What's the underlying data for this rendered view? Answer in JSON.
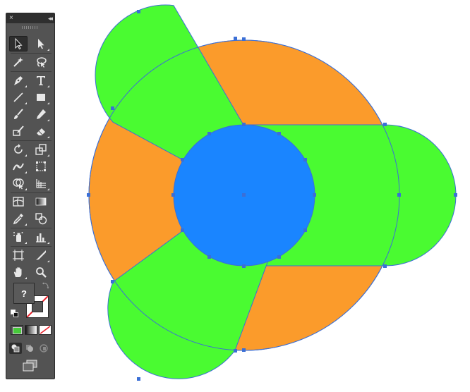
{
  "panel": {
    "close_label": "×",
    "collapse_label": "◂◂"
  },
  "tools": [
    {
      "name": "selection-tool",
      "icon": "arrow-icon",
      "selected": true
    },
    {
      "name": "direct-selection-tool",
      "icon": "white-arrow-icon"
    },
    {
      "name": "magic-wand-tool",
      "icon": "magic-wand-icon"
    },
    {
      "name": "lasso-tool",
      "icon": "lasso-icon"
    },
    {
      "name": "pen-tool",
      "icon": "pen-icon"
    },
    {
      "name": "type-tool",
      "icon": "type-icon",
      "label": "T"
    },
    {
      "name": "line-segment-tool",
      "icon": "line-icon"
    },
    {
      "name": "rectangle-tool",
      "icon": "rectangle-icon"
    },
    {
      "name": "paintbrush-tool",
      "icon": "brush-icon"
    },
    {
      "name": "pencil-tool",
      "icon": "pencil-icon"
    },
    {
      "name": "blob-brush-tool",
      "icon": "blob-brush-icon"
    },
    {
      "name": "eraser-tool",
      "icon": "eraser-icon"
    },
    {
      "name": "rotate-tool",
      "icon": "rotate-icon"
    },
    {
      "name": "scale-tool",
      "icon": "scale-icon"
    },
    {
      "name": "width-tool",
      "icon": "width-icon"
    },
    {
      "name": "free-transform-tool",
      "icon": "free-transform-icon"
    },
    {
      "name": "shape-builder-tool",
      "icon": "shape-builder-icon"
    },
    {
      "name": "perspective-grid-tool",
      "icon": "perspective-grid-icon"
    },
    {
      "name": "mesh-tool",
      "icon": "mesh-icon"
    },
    {
      "name": "gradient-tool",
      "icon": "gradient-icon"
    },
    {
      "name": "eyedropper-tool",
      "icon": "eyedropper-icon"
    },
    {
      "name": "blend-tool",
      "icon": "blend-icon"
    },
    {
      "name": "symbol-sprayer-tool",
      "icon": "symbol-sprayer-icon"
    },
    {
      "name": "column-graph-tool",
      "icon": "column-graph-icon"
    },
    {
      "name": "artboard-tool",
      "icon": "artboard-icon"
    },
    {
      "name": "slice-tool",
      "icon": "slice-icon"
    },
    {
      "name": "hand-tool",
      "icon": "hand-icon"
    },
    {
      "name": "zoom-tool",
      "icon": "zoom-icon"
    }
  ],
  "fill_stroke": {
    "fill_label": "?",
    "stroke_color": "#ffffff",
    "none_slash_color": "#e8202a"
  },
  "color_modes": [
    {
      "name": "color-mode-button",
      "color": "#46c93a"
    },
    {
      "name": "gradient-mode-button",
      "color": "gradient"
    },
    {
      "name": "none-mode-button",
      "color": "none"
    }
  ],
  "artwork": {
    "green": "#4afb31",
    "orange": "#fb9b2b",
    "blue": "#1a85ff",
    "outline": "#3b6fd6",
    "anchor": "#3b6fd6"
  }
}
